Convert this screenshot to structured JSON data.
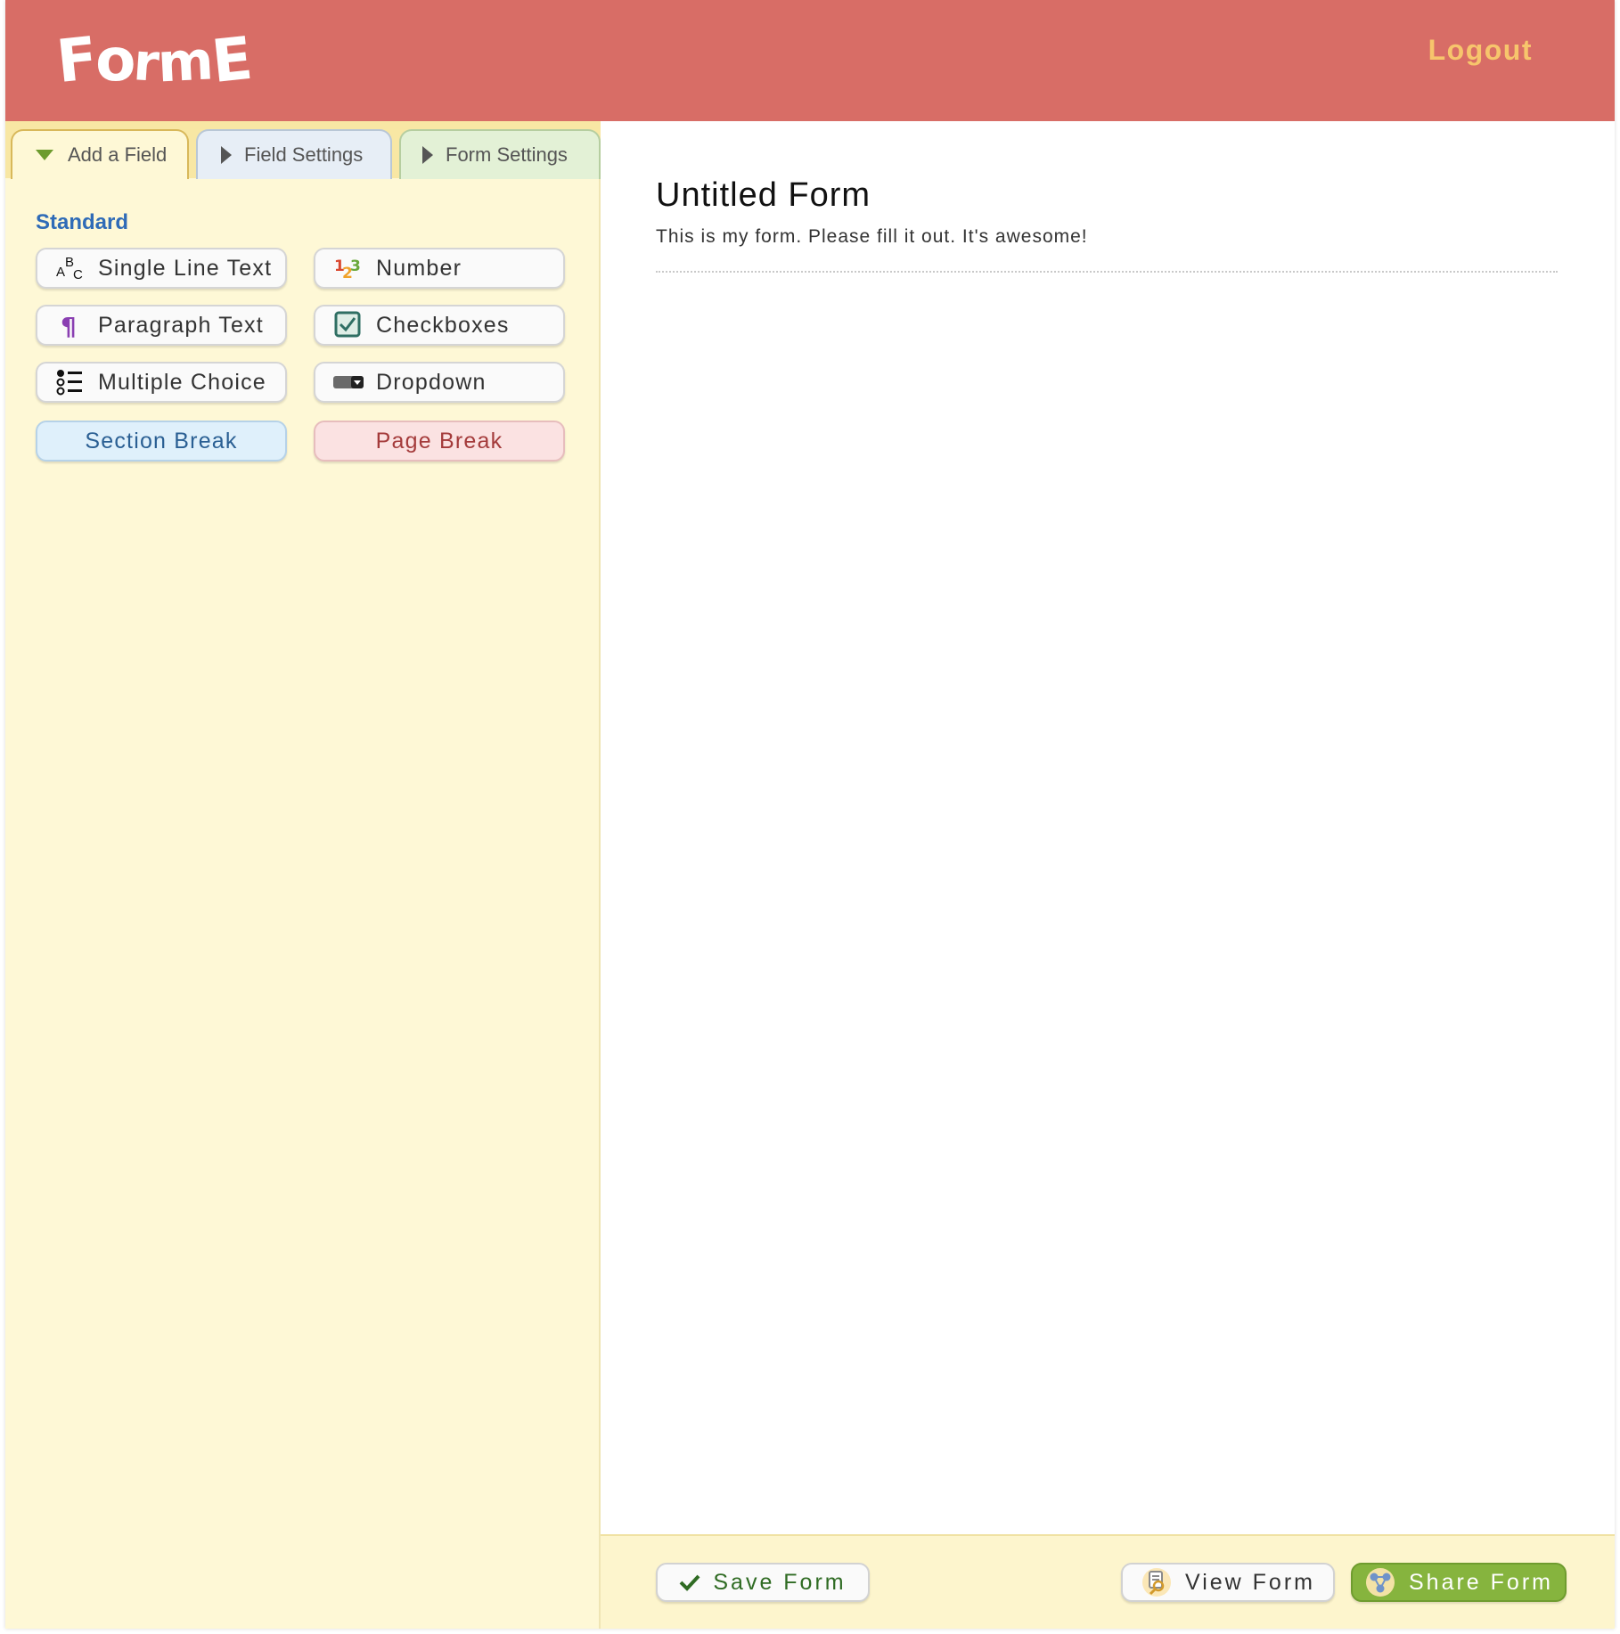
{
  "header": {
    "logo": "FormE",
    "logout_label": "Logout"
  },
  "sidebar": {
    "tabs": [
      {
        "label": "Add a Field"
      },
      {
        "label": "Field Settings"
      },
      {
        "label": "Form Settings"
      }
    ],
    "section_title": "Standard",
    "fields": [
      {
        "label": "Single Line Text",
        "icon": "abc-icon"
      },
      {
        "label": "Number",
        "icon": "numbers-icon"
      },
      {
        "label": "Paragraph Text",
        "icon": "pilcrow-icon"
      },
      {
        "label": "Checkboxes",
        "icon": "checkbox-icon"
      },
      {
        "label": "Multiple Choice",
        "icon": "list-icon"
      },
      {
        "label": "Dropdown",
        "icon": "dropdown-icon"
      },
      {
        "label": "Section Break"
      },
      {
        "label": "Page Break"
      }
    ]
  },
  "main": {
    "form_title": "Untitled Form",
    "form_description": "This is my form. Please fill it out. It's awesome!"
  },
  "footer": {
    "save_label": "Save Form",
    "view_label": "View Form",
    "share_label": "Share Form"
  },
  "colors": {
    "header": "#d86d66",
    "logout": "#f7c56c",
    "sidebar": "#fef8d6",
    "standard_heading": "#2f6bb7",
    "share_button": "#86b43e"
  }
}
